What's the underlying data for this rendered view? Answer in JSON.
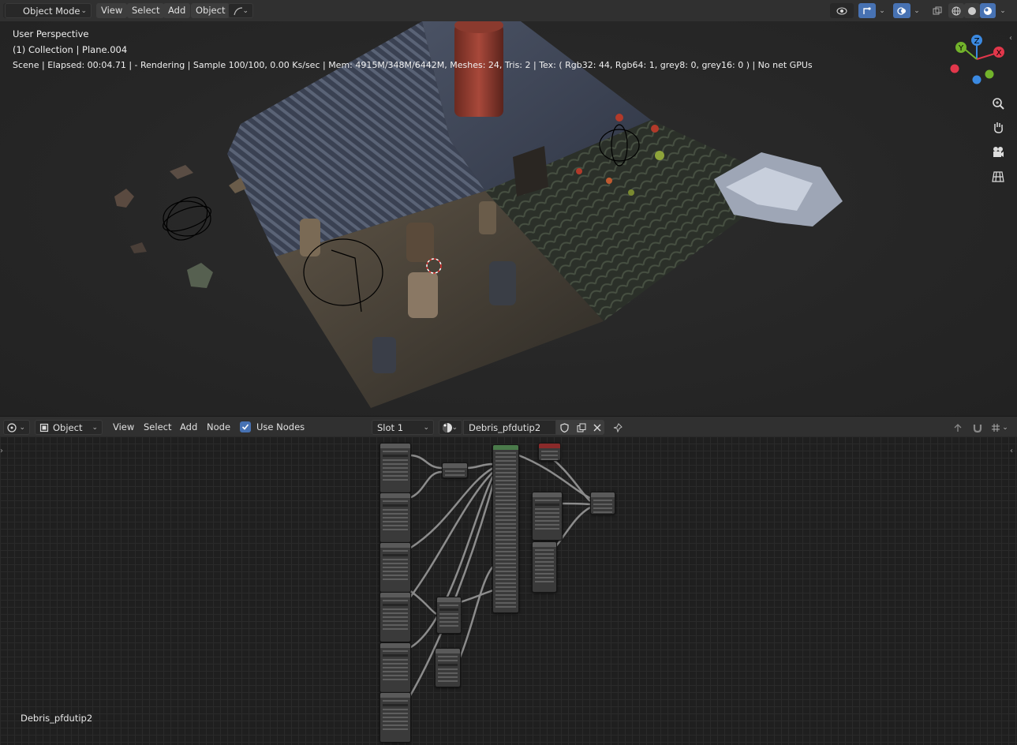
{
  "viewport_header": {
    "mode_label": "Object Mode",
    "menus": [
      "View",
      "Select",
      "Add",
      "Object"
    ]
  },
  "overlay": {
    "line1": "User Perspective",
    "line2": "(1) Collection | Plane.004",
    "line3": "Scene | Elapsed: 00:04.71 |  - Rendering | Sample 100/100, 0.00 Ks/sec | Mem: 4915M/348M/6442M, Meshes: 24, Tris: 2 | Tex: ( Rgb32: 44, Rgb64: 1, grey8: 0, grey16: 0 ) | No net GPUs"
  },
  "gizmo": {
    "axes": [
      "Y",
      "Z",
      "X"
    ],
    "colors": {
      "x": "#e2374b",
      "y": "#72b32b",
      "z": "#3b8ae2"
    }
  },
  "node_header": {
    "editor_type": "Object",
    "menus": [
      "View",
      "Select",
      "Add",
      "Node"
    ],
    "use_nodes_label": "Use Nodes",
    "use_nodes_checked": true,
    "slot_label": "Slot 1",
    "material_name": "Debris_pfdutip2"
  },
  "node_editor": {
    "material_label": "Debris_pfdutip2"
  },
  "colors": {
    "accent": "#4772b3",
    "header_bg": "#303030"
  }
}
